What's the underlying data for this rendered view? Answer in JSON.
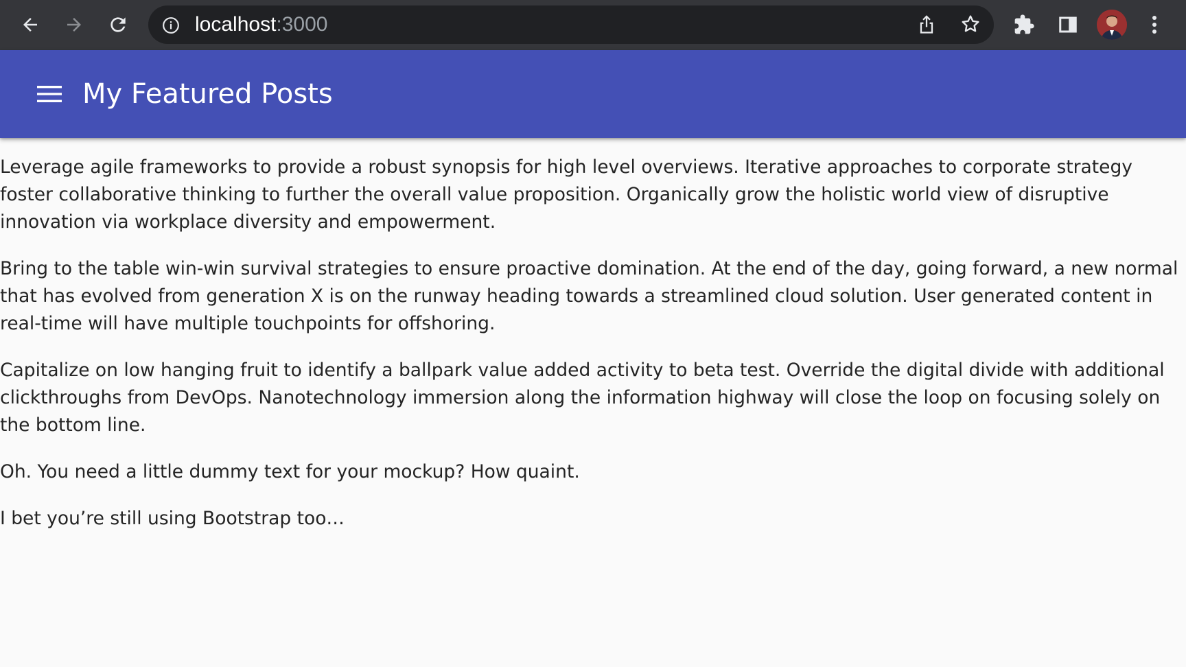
{
  "browser": {
    "url_host": "localhost",
    "url_port": ":3000",
    "icons": [
      "back-arrow-icon",
      "forward-arrow-icon",
      "reload-icon",
      "info-icon",
      "share-icon",
      "star-icon",
      "extensions-puzzle-icon",
      "side-panel-icon",
      "avatar",
      "kebab-menu-icon"
    ]
  },
  "app_bar": {
    "title": "My Featured Posts",
    "menu_icon": "hamburger-menu-icon",
    "color": "#4450b5"
  },
  "content": {
    "paragraphs": [
      "Leverage agile frameworks to provide a robust synopsis for high level overviews. Iterative approaches to corporate strategy foster collaborative thinking to further the overall value proposition. Organically grow the holistic world view of disruptive innovation via workplace diversity and empowerment.",
      "Bring to the table win-win survival strategies to ensure proactive domination. At the end of the day, going forward, a new normal that has evolved from generation X is on the runway heading towards a streamlined cloud solution. User generated content in real-time will have multiple touchpoints for offshoring.",
      "Capitalize on low hanging fruit to identify a ballpark value added activity to beta test. Override the digital divide with additional clickthroughs from DevOps. Nanotechnology immersion along the information highway will close the loop on focusing solely on the bottom line.",
      "Oh. You need a little dummy text for your mockup? How quaint.",
      "I bet you’re still using Bootstrap too…"
    ]
  }
}
